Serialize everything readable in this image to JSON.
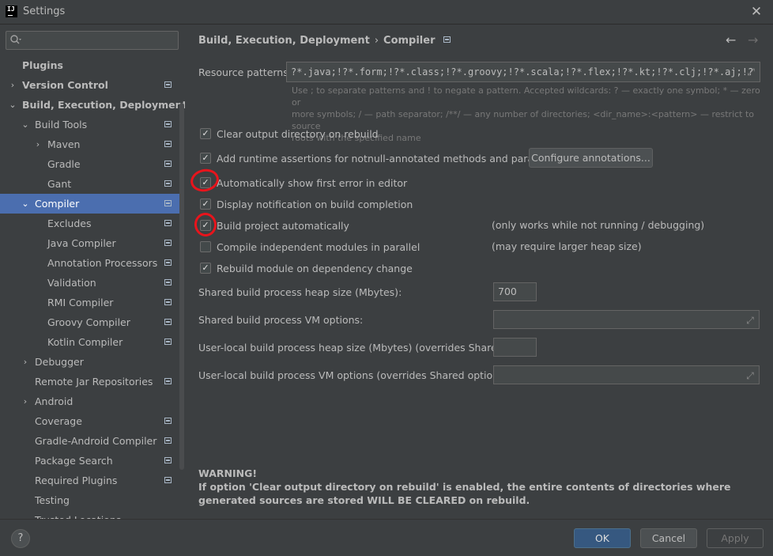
{
  "window": {
    "title": "Settings",
    "app_icon_text": "IJ"
  },
  "search": {
    "value": "",
    "placeholder": ""
  },
  "sidebar": {
    "items": [
      {
        "label": "Plugins"
      },
      {
        "label": "Version Control"
      },
      {
        "label": "Build, Execution, Deployment"
      },
      {
        "label": "Build Tools"
      },
      {
        "label": "Maven"
      },
      {
        "label": "Gradle"
      },
      {
        "label": "Gant"
      },
      {
        "label": "Compiler"
      },
      {
        "label": "Excludes"
      },
      {
        "label": "Java Compiler"
      },
      {
        "label": "Annotation Processors"
      },
      {
        "label": "Validation"
      },
      {
        "label": "RMI Compiler"
      },
      {
        "label": "Groovy Compiler"
      },
      {
        "label": "Kotlin Compiler"
      },
      {
        "label": "Debugger"
      },
      {
        "label": "Remote Jar Repositories"
      },
      {
        "label": "Android"
      },
      {
        "label": "Coverage"
      },
      {
        "label": "Gradle-Android Compiler"
      },
      {
        "label": "Package Search"
      },
      {
        "label": "Required Plugins"
      },
      {
        "label": "Testing"
      },
      {
        "label": "Trusted Locations"
      }
    ]
  },
  "breadcrumb": {
    "parent": "Build, Execution, Deployment",
    "separator": "›",
    "current": "Compiler"
  },
  "resource_patterns": {
    "label": "Resource patterns:",
    "value": "?*.java;!?*.form;!?*.class;!?*.groovy;!?*.scala;!?*.flex;!?*.kt;!?*.clj;!?*.aj;!?",
    "help_line1": "Use ; to separate patterns and ! to negate a pattern. Accepted wildcards: ? — exactly one symbol; * — zero or",
    "help_line2": "more symbols; / — path separator; /**/ — any number of directories; <dir_name>:<pattern> — restrict to source",
    "help_line3": "roots with the specified name"
  },
  "options": {
    "clear_output": {
      "label": "Clear output directory on rebuild",
      "checked": true
    },
    "runtime_assertions": {
      "label": "Add runtime assertions for notnull-annotated methods and parameters",
      "checked": true
    },
    "configure_annotations": "Configure annotations...",
    "show_first_error": {
      "label": "Automatically show first error in editor",
      "checked": true
    },
    "display_notification": {
      "label": "Display notification on build completion",
      "checked": true
    },
    "build_automatically": {
      "label": "Build project automatically",
      "checked": true,
      "hint": "(only works while not running / debugging)"
    },
    "compile_parallel": {
      "label": "Compile independent modules in parallel",
      "checked": false,
      "hint": "(may require larger heap size)"
    },
    "rebuild_dependency": {
      "label": "Rebuild module on dependency change",
      "checked": true
    }
  },
  "fields": {
    "shared_heap_label": "Shared build process heap size (Mbytes):",
    "shared_heap_value": "700",
    "shared_vm_label": "Shared build process VM options:",
    "user_heap_label": "User-local build process heap size (Mbytes) (overrides Shared size):",
    "user_vm_label": "User-local build process VM options (overrides Shared options):"
  },
  "warning": {
    "title": "WARNING!",
    "text": "If option 'Clear output directory on rebuild' is enabled, the entire contents of directories where generated sources are stored WILL BE CLEARED on rebuild."
  },
  "buttons": {
    "help": "?",
    "ok": "OK",
    "cancel": "Cancel",
    "apply": "Apply"
  },
  "colors": {
    "background": "#3c3f41",
    "selection": "#4b6eaf",
    "ok_button": "#365880",
    "annotation": "#e8141c"
  }
}
